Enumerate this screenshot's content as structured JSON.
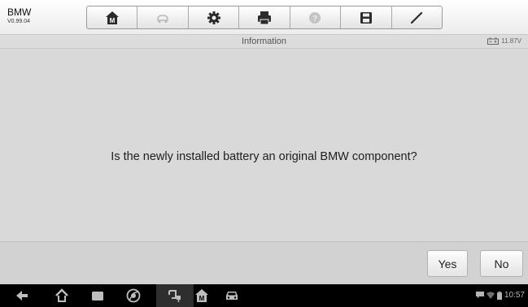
{
  "app": {
    "name": "BMW",
    "version": "V0.99.04"
  },
  "toolbar": {
    "buttons": [
      {
        "icon": "home-m-icon",
        "enabled": true
      },
      {
        "icon": "vehicle-swap-icon",
        "enabled": false
      },
      {
        "icon": "settings-icon",
        "enabled": true
      },
      {
        "icon": "print-icon",
        "enabled": true
      },
      {
        "icon": "help-icon",
        "enabled": false
      },
      {
        "icon": "save-icon",
        "enabled": true
      },
      {
        "icon": "pen-icon",
        "enabled": true
      }
    ]
  },
  "info_bar": {
    "title": "Information",
    "battery_voltage": "11.87V"
  },
  "dialog": {
    "question": "Is the newly installed battery an original BMW component?"
  },
  "actions": {
    "yes_label": "Yes",
    "no_label": "No"
  },
  "system_bar": {
    "time": "10:57"
  },
  "colors": {
    "content_bg": "#d9d9d9",
    "navbar_bg": "#000000",
    "toolbar_bg": "#f2f2f2"
  }
}
